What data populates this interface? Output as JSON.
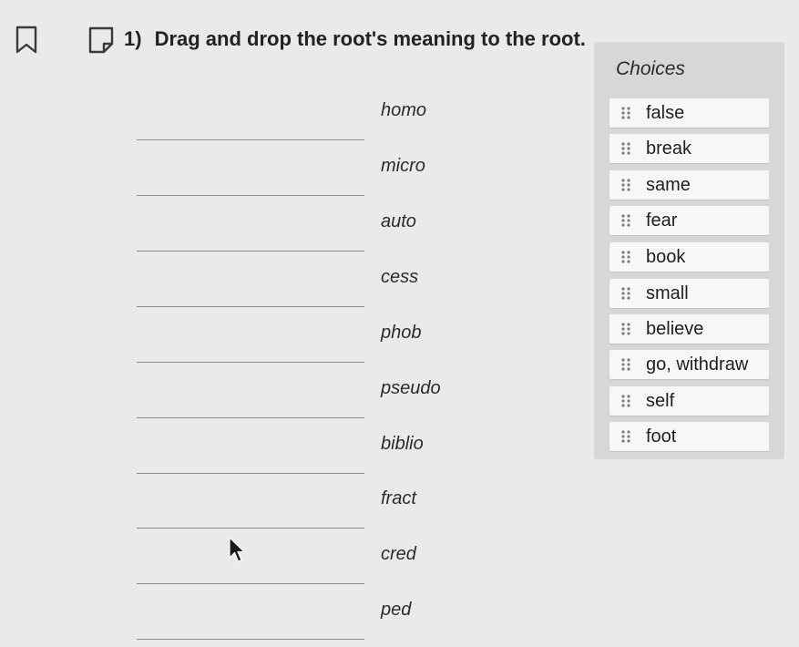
{
  "question": {
    "number": "1)",
    "text": "Drag and drop the root's meaning to the root."
  },
  "toolbar": {
    "bookmark_icon": "bookmark-icon",
    "note_icon": "note-icon"
  },
  "targets": [
    {
      "root": "homo"
    },
    {
      "root": "micro"
    },
    {
      "root": "auto"
    },
    {
      "root": "cess"
    },
    {
      "root": "phob"
    },
    {
      "root": "pseudo"
    },
    {
      "root": "biblio"
    },
    {
      "root": "fract"
    },
    {
      "root": "cred"
    },
    {
      "root": "ped"
    }
  ],
  "choices": {
    "title": "Choices",
    "items": [
      {
        "label": "false"
      },
      {
        "label": "break"
      },
      {
        "label": "same"
      },
      {
        "label": "fear"
      },
      {
        "label": "book"
      },
      {
        "label": "small"
      },
      {
        "label": "believe"
      },
      {
        "label": "go, withdraw"
      },
      {
        "label": "self"
      },
      {
        "label": "foot"
      }
    ]
  },
  "colors": {
    "background": "#e9eaec",
    "panel": "#d6d7d9",
    "choice_bg": "#f7f7f7",
    "text": "#2a2a2a"
  }
}
